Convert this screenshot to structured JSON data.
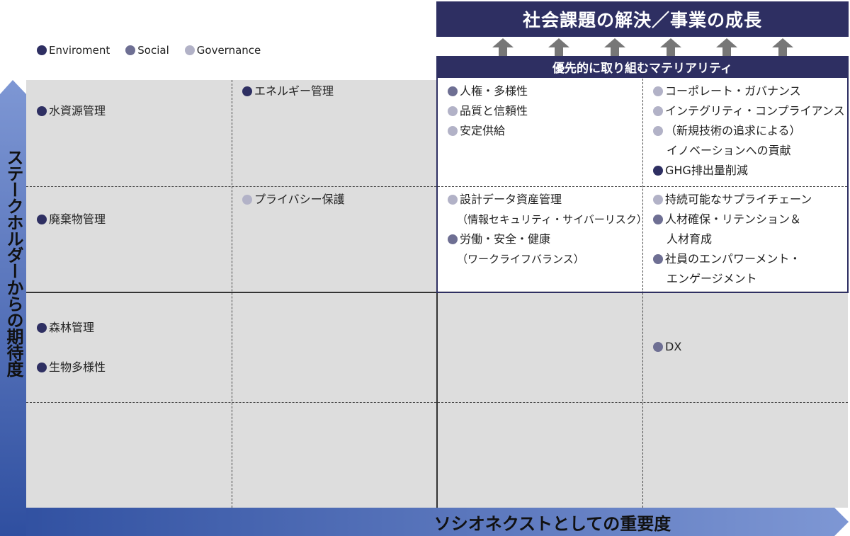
{
  "header": {
    "title": "社会課題の解決／事業の成長"
  },
  "legend": [
    {
      "label": "Enviroment",
      "color": "#2e2f62"
    },
    {
      "label": "Social",
      "color": "#6e6f93"
    },
    {
      "label": "Governance",
      "color": "#b2b2c7"
    }
  ],
  "priority_box": {
    "title": "優先的に取り組むマテリアリティ"
  },
  "axes": {
    "x_label": "ソシオネクストとしての重要度",
    "y_label": "ステークホルダーからの期待度"
  },
  "items": {
    "water": "水資源管理",
    "energy": "エネルギー管理",
    "waste": "廃棄物管理",
    "privacy": "プライバシー保護",
    "forest": "森林管理",
    "biodiversity": "生物多様性",
    "human_rights": "人権・多様性",
    "quality": "品質と信頼性",
    "supply": "安定供給",
    "corp_gov": "コーポレート・ガバナンス",
    "integrity": "インテグリティ・コンプライアンス",
    "innovation_1": "（新規技術の追求による）",
    "innovation_2": "イノベーションへの貢献",
    "ghg": "GHG排出量削減",
    "design_data_1": "設計データ資産管理",
    "design_data_2": "（情報セキュリティ・サイバーリスク）",
    "labor_1": "労働・安全・健康",
    "labor_2": "（ワークライフバランス）",
    "sustain_supply": "持続可能なサプライチェーン",
    "talent_1": "人材確保・リテンション＆",
    "talent_2": "人材育成",
    "engage_1": "社員のエンパワーメント・",
    "engage_2": "エンゲージメント",
    "dx": "DX"
  }
}
